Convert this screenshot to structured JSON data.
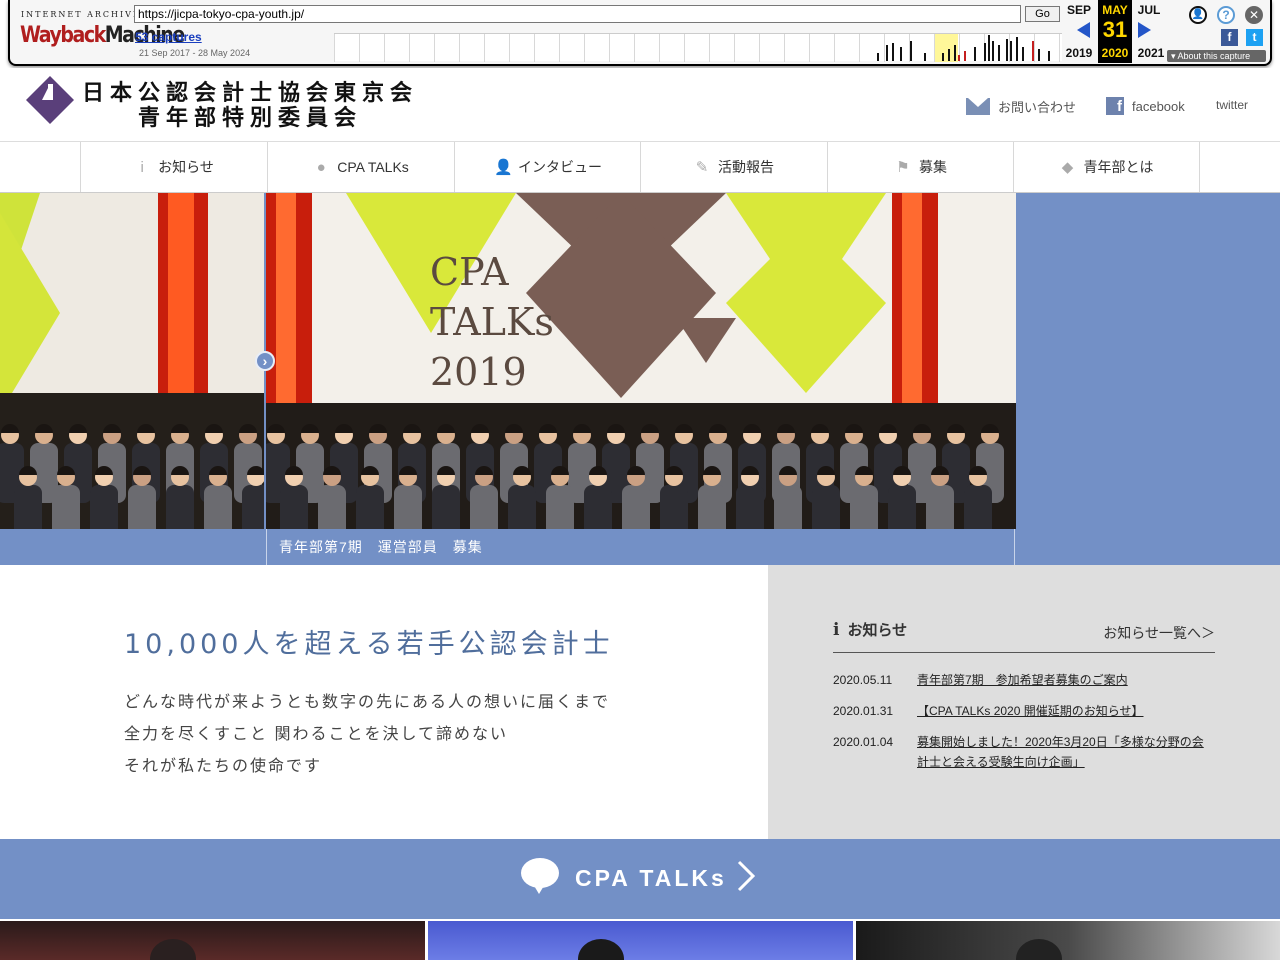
{
  "wayback": {
    "logo_small": "INTERNET ARCHIVE",
    "logo_part1": "Wayback",
    "logo_part2": "Machine",
    "url": "https://jicpa-tokyo-cpa-youth.jp/",
    "go_label": "Go",
    "captures": "53 captures",
    "date_range": "21 Sep 2017 - 28 May 2024",
    "prev_month": "SEP",
    "prev_year": "2019",
    "cur_month": "MAY",
    "cur_day": "31",
    "cur_year": "2020",
    "next_month": "JUL",
    "next_year": "2021",
    "about": "About this capture",
    "fb_glyph": "f",
    "tw_glyph": "t",
    "help_glyph": "?",
    "close_glyph": "✕",
    "user_glyph": "👤"
  },
  "header": {
    "title_line1": "日本公認会計士協会東京会",
    "title_line2": "青年部特別委員会",
    "contact": "お問い合わせ",
    "facebook": "facebook",
    "twitter": "twitter"
  },
  "nav": [
    {
      "label": "お知らせ",
      "icon": "i"
    },
    {
      "label": "CPA TALKs",
      "icon": "●"
    },
    {
      "label": "インタビュー",
      "icon": "👤"
    },
    {
      "label": "活動報告",
      "icon": "✎"
    },
    {
      "label": "募集",
      "icon": "⚑"
    },
    {
      "label": "青年部とは",
      "icon": "◆"
    }
  ],
  "hero": {
    "caption": "青年部第7期　運営部員　募集",
    "stage_line1": "CPA",
    "stage_line2": "TALKs",
    "stage_line3": "2019",
    "arrow": "›"
  },
  "intro": {
    "heading": "10,000人を超える若手公認会計士",
    "lines": [
      "どんな時代が来ようとも数字の先にある人の想いに届くまで",
      "全力を尽くすこと 関わることを決して諦めない",
      "それが私たちの使命です"
    ]
  },
  "news": {
    "title": "お知らせ",
    "title_icon": "i",
    "more": "お知らせ一覧へ＞",
    "items": [
      {
        "date": "2020.05.11",
        "text": "青年部第7期　参加希望者募集のご案内"
      },
      {
        "date": "2020.01.31",
        "text": "【CPA TALKs 2020 開催延期のお知らせ】"
      },
      {
        "date": "2020.01.04",
        "text": "募集開始しました！2020年3月20日「多様な分野の会計士と会える受験生向け企画」"
      }
    ]
  },
  "talks": {
    "label": "CPA TALKs"
  },
  "colors": {
    "accent": "#7390c6",
    "heading": "#506e9c",
    "news_bg": "#dedede"
  }
}
